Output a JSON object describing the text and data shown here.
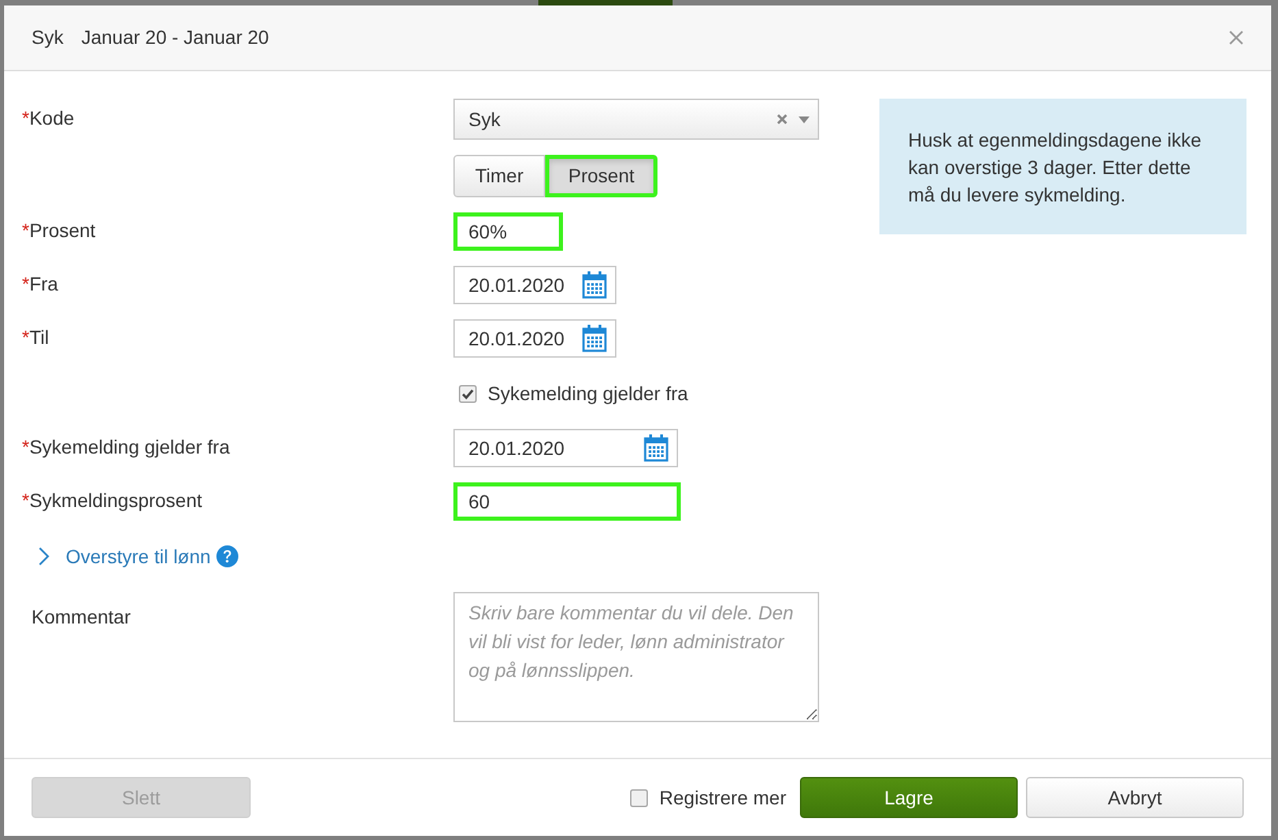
{
  "dialog": {
    "title": "Syk",
    "subtitle": "Januar 20 - Januar 20"
  },
  "fields": [
    {
      "kind": "select",
      "label": "Kode",
      "marker": "*",
      "value": "Syk"
    },
    {
      "kind": "toggle",
      "options": [
        {
          "label": "Timer",
          "selected": false,
          "highlighted": false
        },
        {
          "label": "Prosent",
          "selected": true,
          "highlighted": true
        }
      ]
    },
    {
      "kind": "text",
      "label": "Prosent",
      "marker": "*",
      "value": "60%",
      "highlighted": true
    },
    {
      "kind": "date",
      "label": "Fra",
      "marker": "*",
      "value": "20.01.2020"
    },
    {
      "kind": "date",
      "label": "Til",
      "marker": "*",
      "value": "20.01.2020"
    },
    {
      "kind": "checkbox",
      "label": "Sykemelding gjelder fra",
      "checked": true
    },
    {
      "kind": "date",
      "label": "Sykemelding gjelder fra",
      "marker": "*",
      "value": "20.01.2020"
    },
    {
      "kind": "text",
      "label": "Sykmeldingsprosent",
      "marker": "*",
      "value": "60",
      "highlighted": true
    },
    {
      "kind": "expander",
      "label": "Overstyre til lønn",
      "expanded": false
    },
    {
      "kind": "textarea",
      "label": "Kommentar",
      "placeholder": "Skriv bare kommentar du vil dele. Den vil bli vist for leder, lønn administrator og på lønnsslippen."
    }
  ],
  "info": "Husk at egenmeldingsdagene ikke kan overstige 3 dager. Etter dette må du levere sykmelding.",
  "footer": {
    "delete_button": {
      "label": "Slett",
      "disabled": true
    },
    "register_more": {
      "label": "Registrere mer",
      "checked": false
    },
    "save_button": "Lagre",
    "cancel_button": "Avbryt"
  }
}
